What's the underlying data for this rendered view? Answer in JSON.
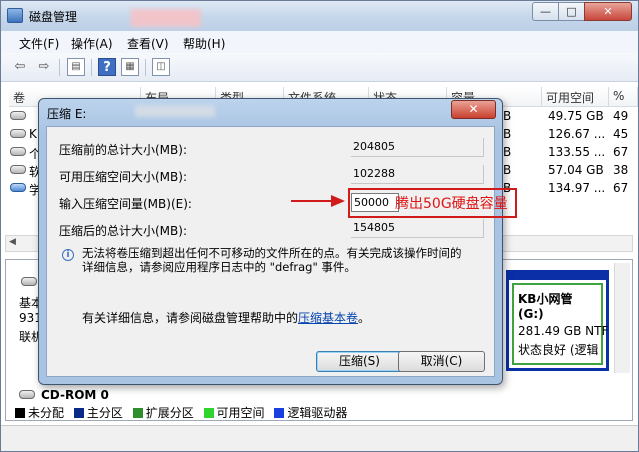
{
  "window": {
    "title": "磁盘管理",
    "controls": {
      "minimize": "—",
      "maximize": "□",
      "close": "✕"
    }
  },
  "menubar": [
    "文件(F)",
    "操作(A)",
    "查看(V)",
    "帮助(H)"
  ],
  "toolbar_icons": [
    "back-arrow-icon",
    "forward-arrow-icon",
    "console-tree-icon",
    "help-icon",
    "properties-icon",
    "wizard-icon"
  ],
  "volume_list": {
    "headers": [
      "卷",
      "布局",
      "类型",
      "文件系统",
      "状态",
      "容量",
      "可用空间",
      "%"
    ],
    "rows": [
      {
        "name": "",
        "free": "49.75 GB",
        "pct": "49"
      },
      {
        "name": "K",
        "free": "126.67 ...",
        "pct": "45"
      },
      {
        "name": "个",
        "free": "133.55 ...",
        "pct": "67"
      },
      {
        "name": "软",
        "free": "57.04 GB",
        "pct": "38"
      },
      {
        "name": "学",
        "free": "134.97 ...",
        "pct": "67"
      }
    ],
    "capacity_tails": [
      "B",
      "B",
      "B",
      "B",
      "B"
    ]
  },
  "lower_pane": {
    "disk_labels": [
      "基本",
      "931",
      "联机"
    ],
    "volume": {
      "name": "KB小网管  (G:)",
      "size": "281.49 GB NTF",
      "status": "状态良好 (逻辑"
    },
    "cdrom_label": "CD-ROM 0"
  },
  "legend": [
    {
      "label": "未分配",
      "color": "#000000"
    },
    {
      "label": "主分区",
      "color": "#0a2a8a"
    },
    {
      "label": "扩展分区",
      "color": "#2f8f2f"
    },
    {
      "label": "可用空间",
      "color": "#2fd42f"
    },
    {
      "label": "逻辑驱动器",
      "color": "#1a3fe0"
    }
  ],
  "dialog": {
    "title": "压缩 E:",
    "close_label": "✕",
    "fields": [
      {
        "label": "压缩前的总计大小(MB):",
        "value": "204805"
      },
      {
        "label": "可用压缩空间大小(MB):",
        "value": "102288"
      },
      {
        "label": "输入压缩空间量(MB)(E):",
        "value": "50000"
      },
      {
        "label": "压缩后的总计大小(MB):",
        "value": "154805"
      }
    ],
    "info_line1": "无法将卷压缩到超出任何不可移动的文件所在的点。有关完成该操作时间的",
    "info_line2": "详细信息，请参阅应用程序日志中的 \"defrag\" 事件。",
    "help_prefix": "有关详细信息，请参阅磁盘管理帮助中的",
    "help_link": "压缩基本卷",
    "help_suffix": "。",
    "ok_button": "压缩(S)",
    "cancel_button": "取消(C)"
  },
  "annotation": {
    "text": "腾出50G硬盘容量",
    "color": "#d11a1a"
  }
}
